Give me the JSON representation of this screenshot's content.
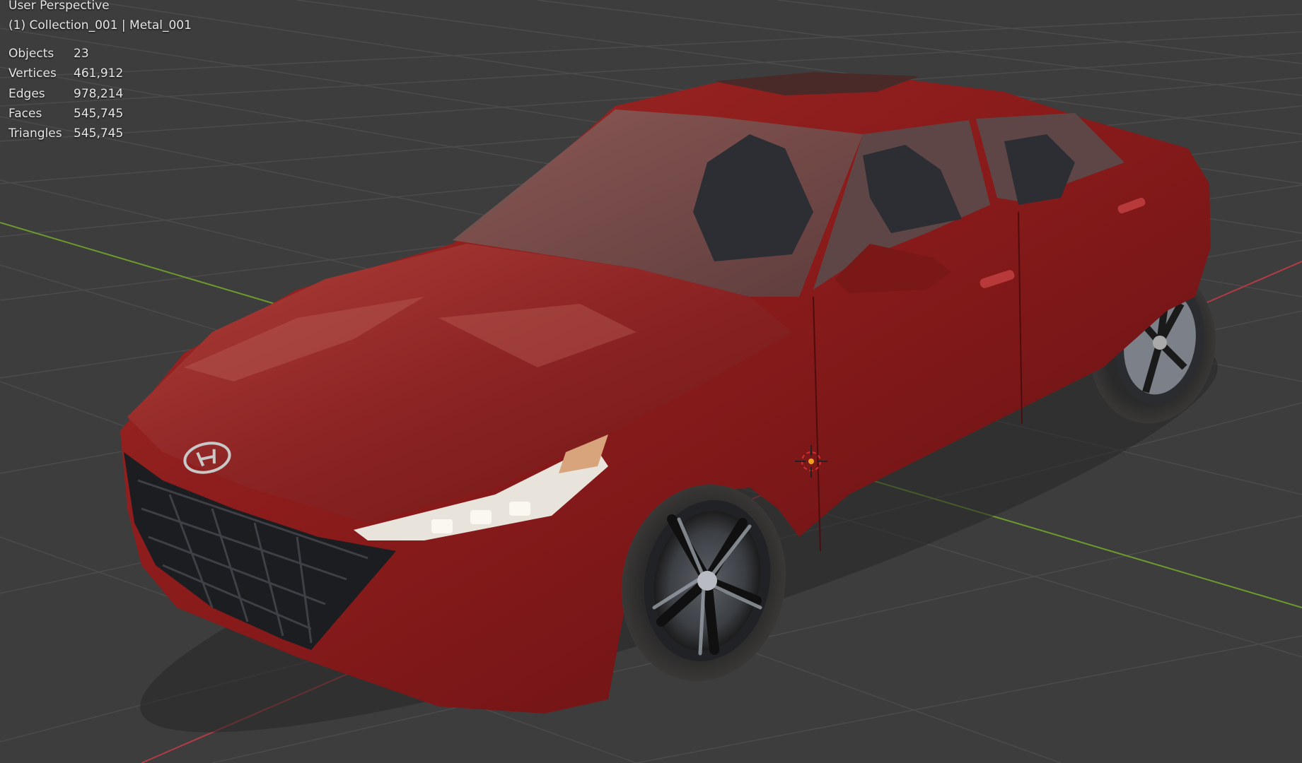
{
  "viewport": {
    "view_name": "User Perspective",
    "object_info": "(1) Collection_001 | Metal_001",
    "stats": [
      {
        "label": "Objects",
        "value": "23"
      },
      {
        "label": "Vertices",
        "value": "461,912"
      },
      {
        "label": "Edges",
        "value": "978,214"
      },
      {
        "label": "Faces",
        "value": "545,745"
      },
      {
        "label": "Triangles",
        "value": "545,745"
      }
    ]
  },
  "colors": {
    "background": "#3d3d3d",
    "grid_line": "#4e4e4e",
    "x_axis": "#b23b45",
    "y_axis": "#6d9a2e",
    "car_body": "#8c1c1c",
    "text": "#e6e6e6"
  },
  "icons": {
    "origin_cursor": "3d-cursor-icon"
  }
}
